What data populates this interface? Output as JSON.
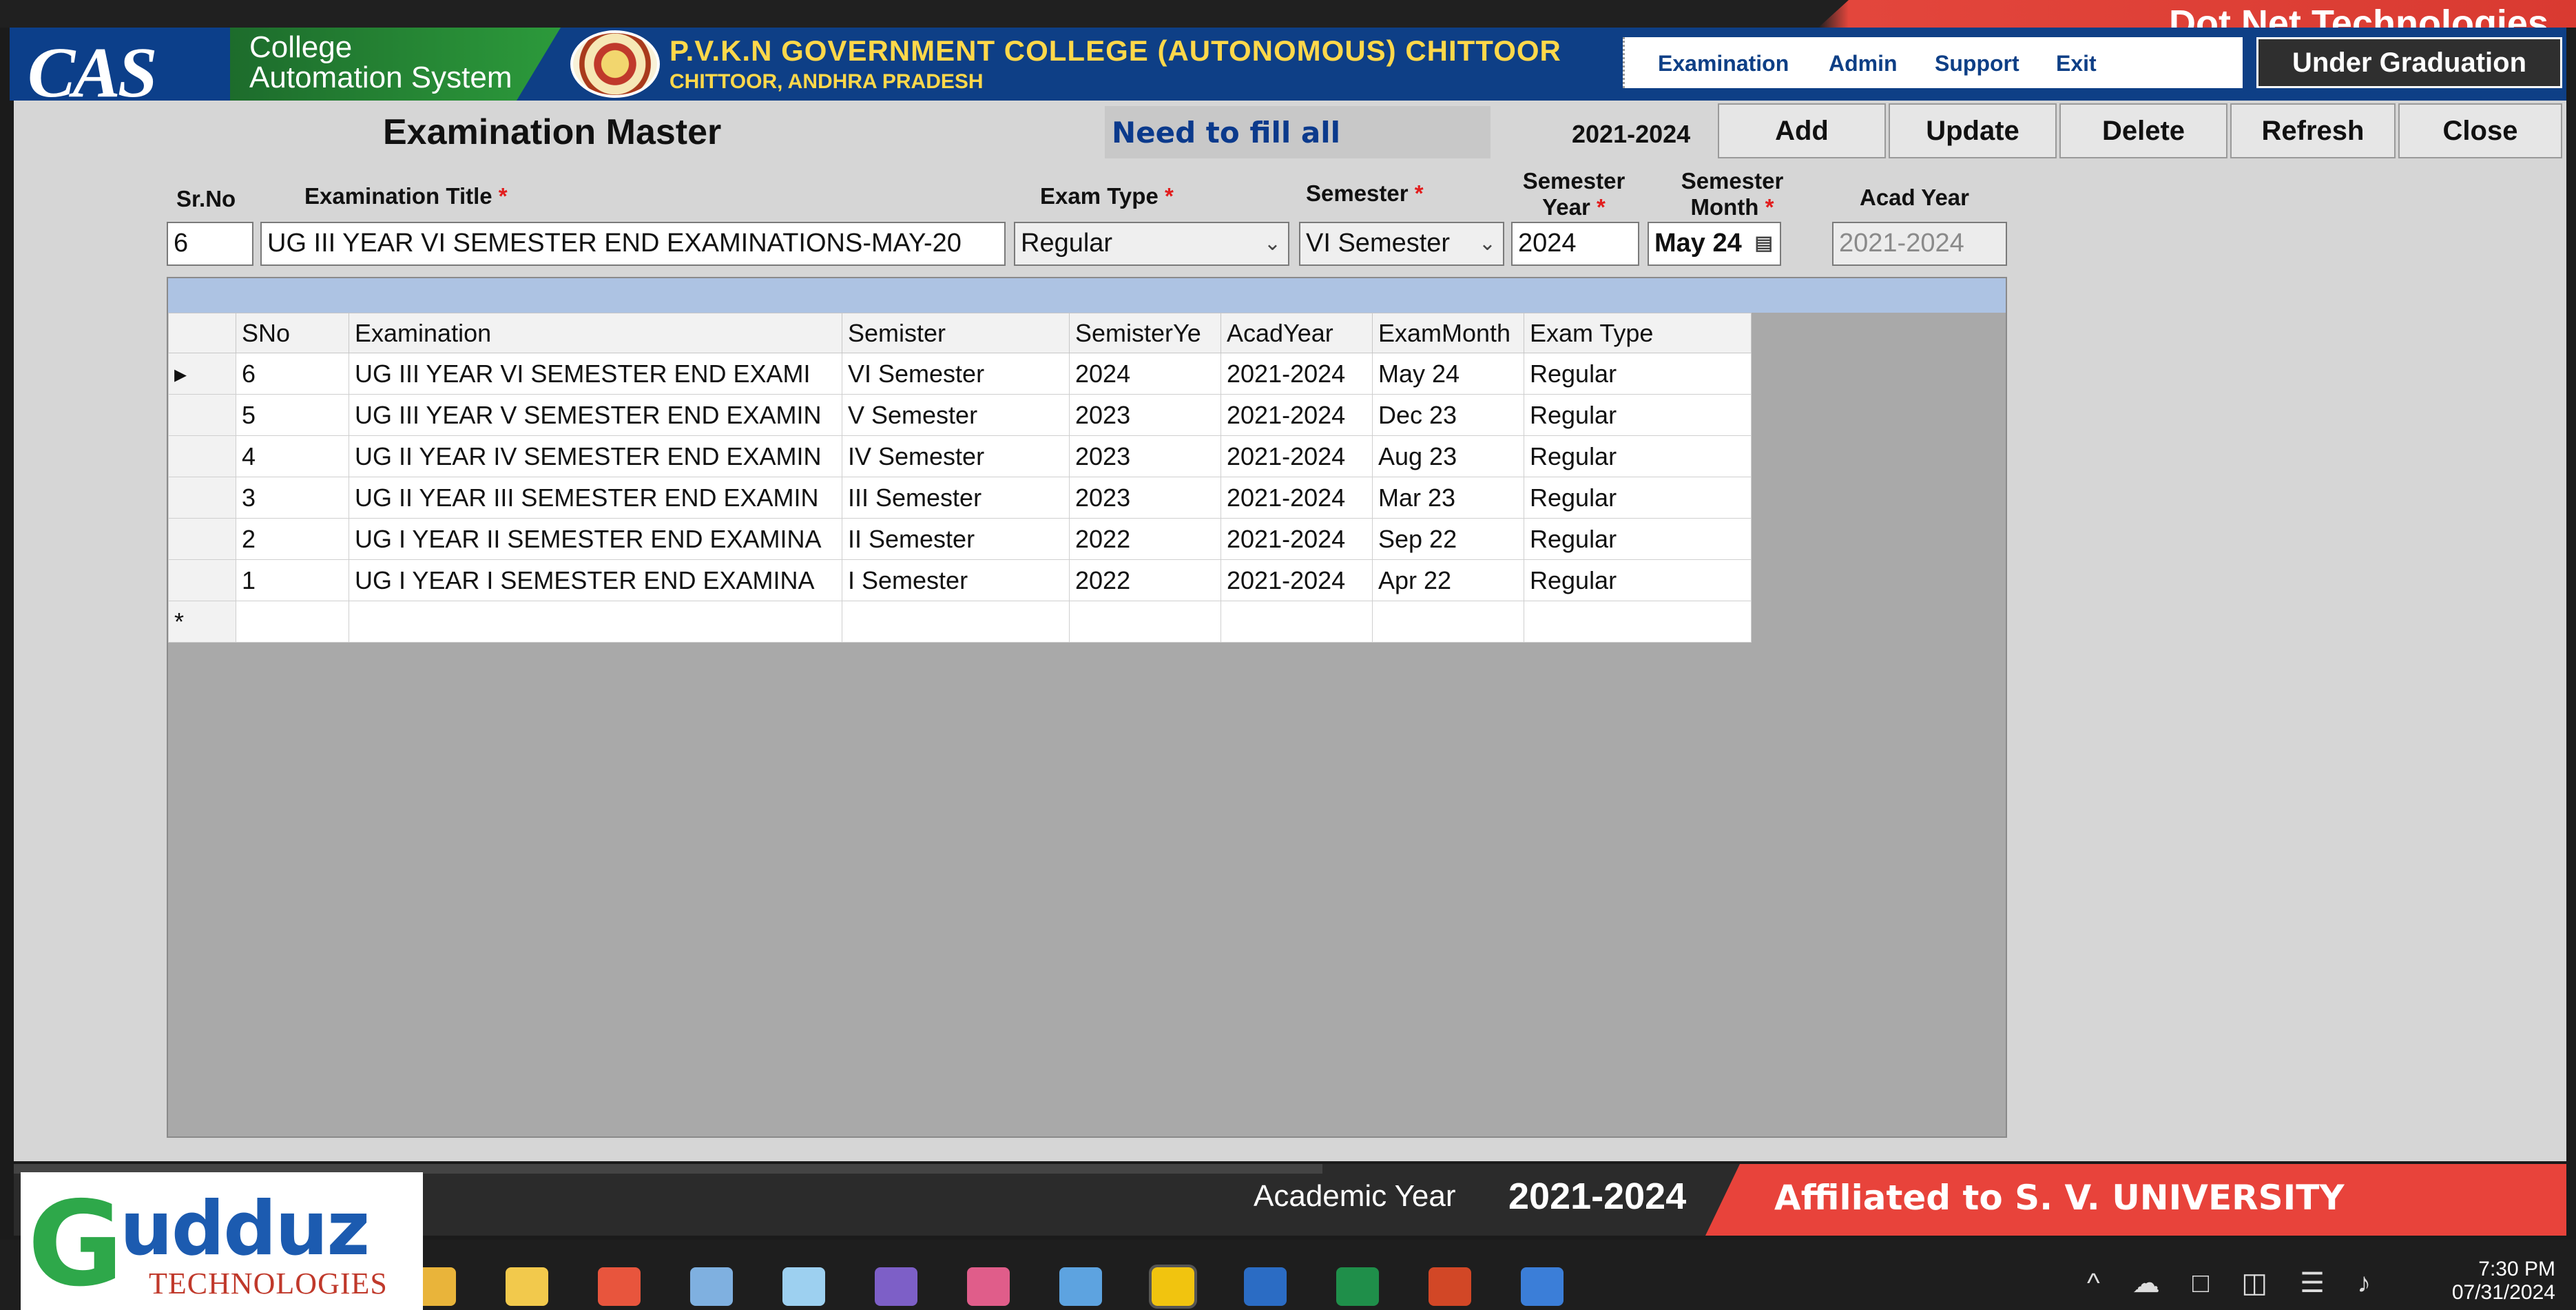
{
  "vendor": {
    "name": "Dot Net Technologies"
  },
  "header": {
    "logo_text": "CAS",
    "app_name_line1": "College",
    "app_name_line2": "Automation System",
    "college_name": "P.V.K.N GOVERNMENT COLLEGE (AUTONOMOUS) CHITTOOR",
    "college_city": "CHITTOOR, ANDHRA PRADESH",
    "menu": [
      "Examination",
      "Admin",
      "Support",
      "Exit"
    ],
    "program": "Under Graduation"
  },
  "screen": {
    "title": "Examination Master",
    "message": "Need to fill all",
    "acad_year": "2021-2024",
    "buttons": {
      "add": "Add",
      "update": "Update",
      "delete": "Delete",
      "refresh": "Refresh",
      "close": "Close"
    }
  },
  "form": {
    "labels": {
      "srno": "Sr.No",
      "title": "Examination Title",
      "exam_type": "Exam Type",
      "semester": "Semester",
      "sem_year_1": "Semester",
      "sem_year_2": "Year",
      "sem_month_1": "Semester",
      "sem_month_2": "Month",
      "acad_year": "Acad Year",
      "required": "*"
    },
    "values": {
      "srno": "6",
      "title": "UG III YEAR VI SEMESTER END EXAMINATIONS-MAY-20",
      "exam_type": "Regular",
      "semester": "VI Semester",
      "sem_year": "2024",
      "sem_month": "May 24",
      "acad_year": "2021-2024"
    }
  },
  "grid": {
    "columns": [
      "SNo",
      "Examination",
      "Semister",
      "SemisterYe",
      "AcadYear",
      "ExamMonth",
      "Exam Type"
    ],
    "rows": [
      [
        "6",
        "UG III YEAR VI SEMESTER END EXAMI",
        "VI Semester",
        "2024",
        "2021-2024",
        "May 24",
        "Regular"
      ],
      [
        "5",
        "UG III YEAR V SEMESTER END EXAMIN",
        "V Semester",
        "2023",
        "2021-2024",
        "Dec 23",
        "Regular"
      ],
      [
        "4",
        "UG II YEAR IV SEMESTER END EXAMIN",
        "IV Semester",
        "2023",
        "2021-2024",
        "Aug 23",
        "Regular"
      ],
      [
        "3",
        "UG II YEAR III SEMESTER END EXAMIN",
        "III Semester",
        "2023",
        "2021-2024",
        "Mar 23",
        "Regular"
      ],
      [
        "2",
        "UG I YEAR II SEMESTER END EXAMINA",
        "II Semester",
        "2022",
        "2021-2024",
        "Sep 22",
        "Regular"
      ],
      [
        "1",
        "UG I YEAR I SEMESTER END EXAMINA",
        "I Semester",
        "2022",
        "2021-2024",
        "Apr 22",
        "Regular"
      ]
    ],
    "current_row_marker": "▸",
    "new_row_marker": "*"
  },
  "status": {
    "acad_label": "Academic Year",
    "acad_value": "2021-2024",
    "affiliation": "Affiliated to S. V. UNIVERSITY"
  },
  "brand": {
    "letter": "G",
    "rest": "udduz",
    "sub": "TECHNOLOGIES"
  },
  "taskbar": {
    "time": "7:30 PM",
    "date": "07/31/2024",
    "apps": [
      "chrome-icon",
      "file-explorer-icon",
      "git-icon",
      "media-icon",
      "tools-icon",
      "visual-studio-icon",
      "key-icon",
      "remote-icon",
      "power-bi-icon",
      "word-icon",
      "excel-icon",
      "powerpoint-icon",
      "app-icon"
    ],
    "app_colors": [
      "#e9b43a",
      "#f2c94c",
      "#e8553d",
      "#7fb0e0",
      "#9dd0f0",
      "#7d5fc7",
      "#e05d8a",
      "#5da3e0",
      "#f1c40f",
      "#2b6cc4",
      "#1f8f4a",
      "#d24726",
      "#3b7ed8"
    ]
  }
}
